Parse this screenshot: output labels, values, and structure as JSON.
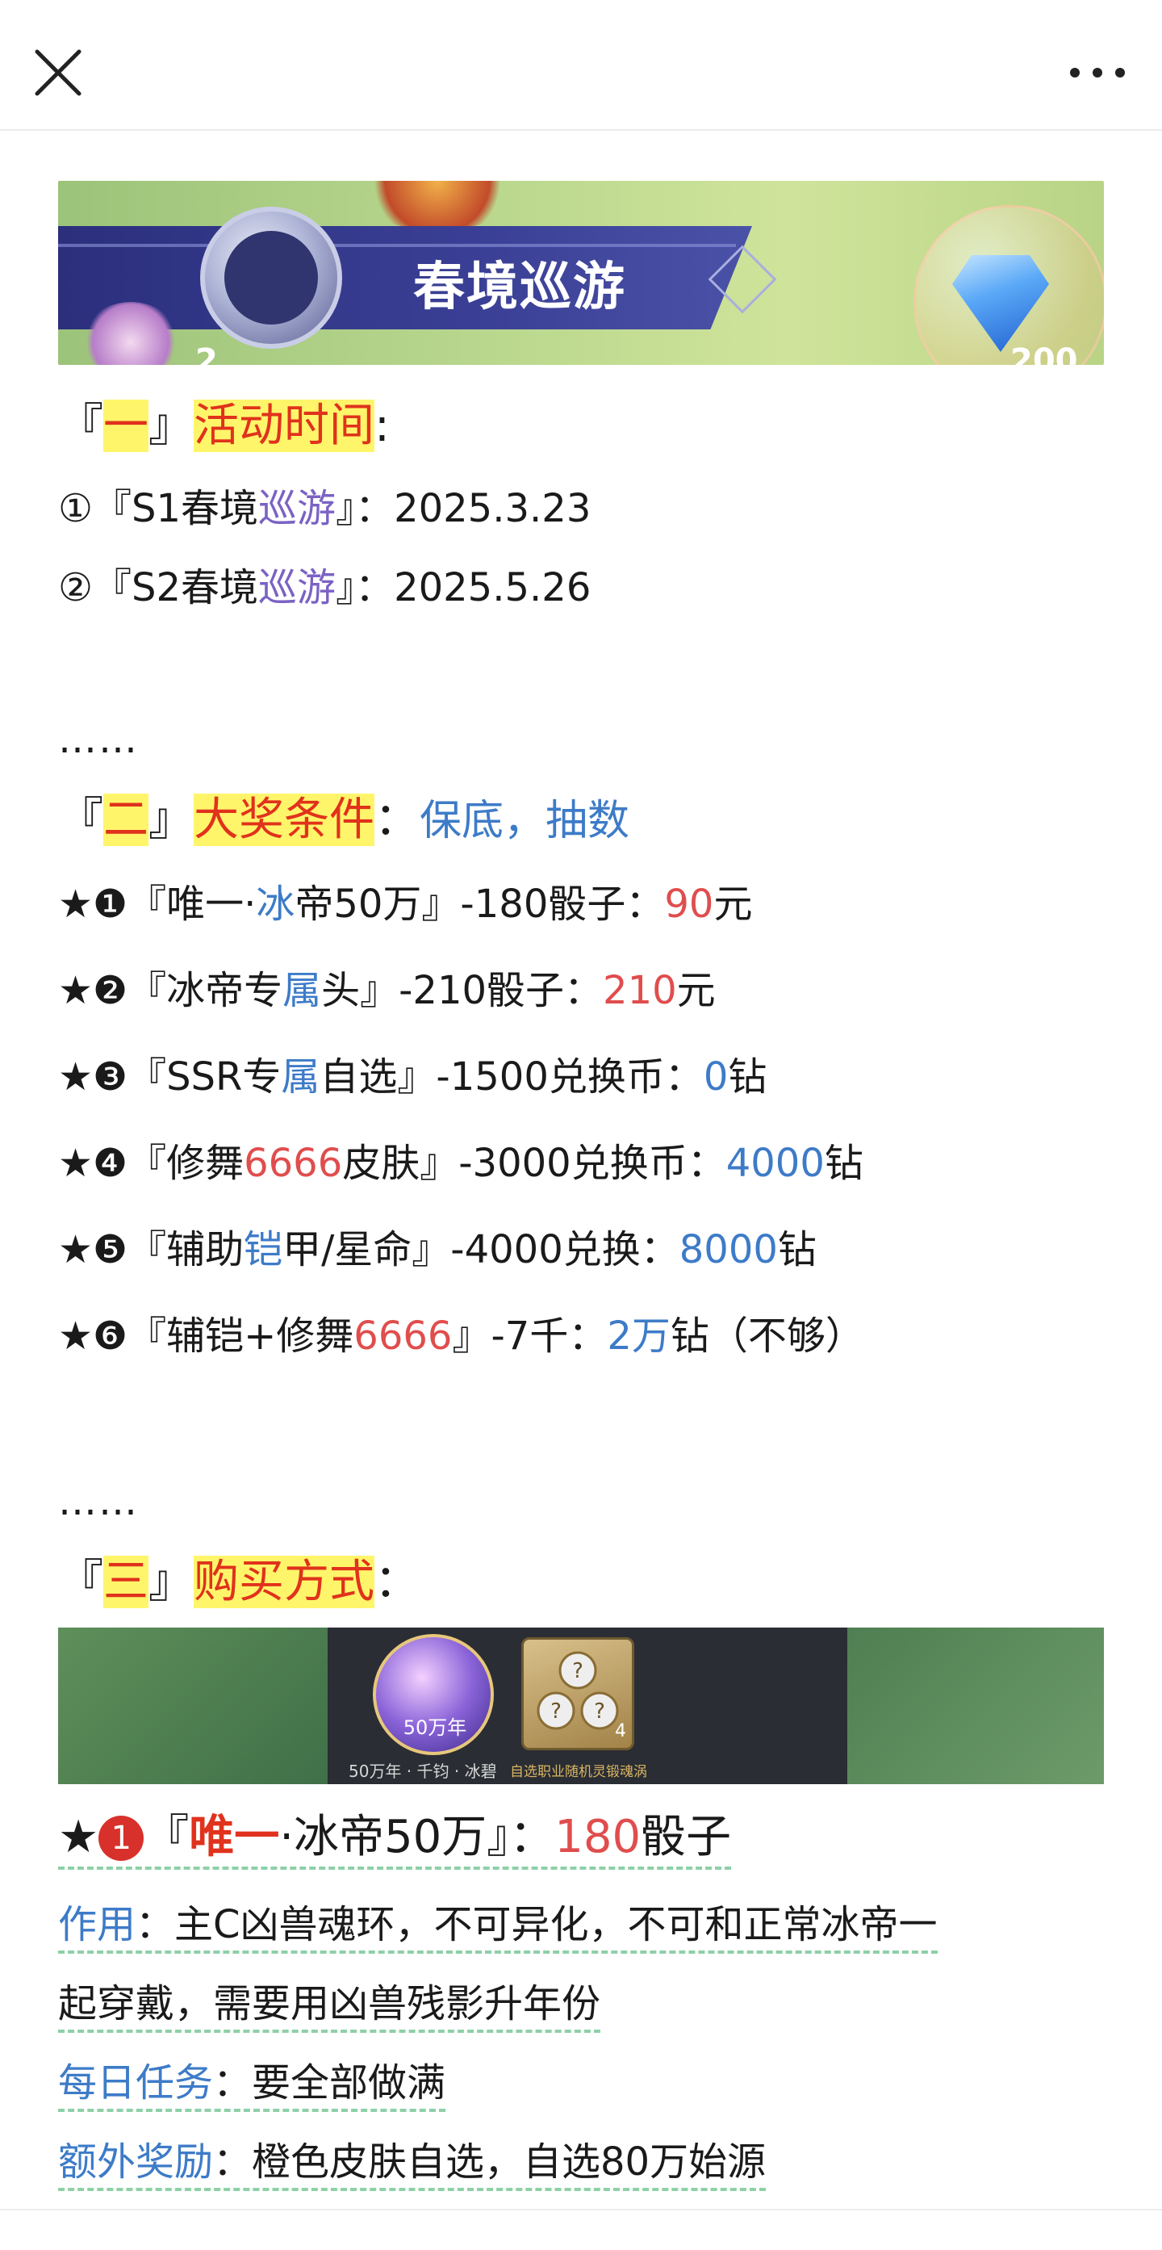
{
  "toolbar": {
    "close_icon": "close-icon",
    "more_icon": "more-dots-icon"
  },
  "banner": {
    "title": "春境巡游",
    "num_left": "2",
    "num_right": "200"
  },
  "section1": {
    "open": "『",
    "num": "一",
    "close": "』",
    "title": "活动时间",
    "colon": ":",
    "items": [
      {
        "prefix": "①『S1春境",
        "accent": "巡游",
        "suffix": "』：2025.3.23"
      },
      {
        "prefix": "②『S2春境",
        "accent": "巡游",
        "suffix": "』：2025.5.26"
      }
    ]
  },
  "separator": "……",
  "section2": {
    "open": "『",
    "num": "二",
    "close": "』",
    "title": "大奖条件",
    "colon": "：",
    "tail": "保底，抽数",
    "items": [
      {
        "a": "★❶『唯一·",
        "b": "冰",
        "c": "帝50万』-180骰子：",
        "d": "90",
        "e": "元",
        "d_color": "red"
      },
      {
        "a": "★❷『冰帝专",
        "b": "属",
        "c": "头』-210骰子：",
        "d": "210",
        "e": "元",
        "d_color": "red"
      },
      {
        "a": "★❸『SSR专",
        "b": "属",
        "c": "自选』-1500兑换币：",
        "d": "0",
        "e": "钻",
        "d_color": "blue"
      },
      {
        "a": "★❹『修舞",
        "b": "6666",
        "c": "皮肤』-3000兑换币：",
        "d": "4000",
        "e": "钻",
        "d_color": "blue",
        "b_color": "red"
      },
      {
        "a": "★❺『辅助",
        "b": "铠",
        "c": "甲/星命』-4000兑换：",
        "d": "8000",
        "e": "钻",
        "d_color": "blue"
      },
      {
        "a": "★❻『辅铠+修舞",
        "b": "6666",
        "c": "』-7千：",
        "d": "2万",
        "e": "钻（不够）",
        "d_color": "blue",
        "b_color": "red"
      }
    ]
  },
  "section3": {
    "open": "『",
    "num": "三",
    "close": "』",
    "title": "购买方式",
    "colon": "："
  },
  "shop": {
    "item1_label": "50万年",
    "item2_qty": "4",
    "cap1": "50万年 · 千钧 · 冰碧",
    "cap2": "自选职业随机灵锻魂涡"
  },
  "detail": {
    "star": "★",
    "circle": "1",
    "open": "『",
    "name": "唯一",
    "rest": "·冰帝50万』：",
    "price": "180",
    "unit": "骰子",
    "effect_label": "作用",
    "effect_text1": "：主C凶兽魂环，不可异化，不可和正常冰帝一",
    "effect_text2": "起穿戴，需要用凶兽残影升年份",
    "daily_label": "每日任务",
    "daily_text": "：要全部做满",
    "bonus_label": "额外奖励",
    "bonus_text": "：橙色皮肤自选，自选80万始源"
  },
  "colors": {
    "highlight": "#fff56a",
    "highlight_text": "#e0321c",
    "blue": "#3d7bc8",
    "red": "#e04d4d",
    "purple": "#7b62c4"
  }
}
